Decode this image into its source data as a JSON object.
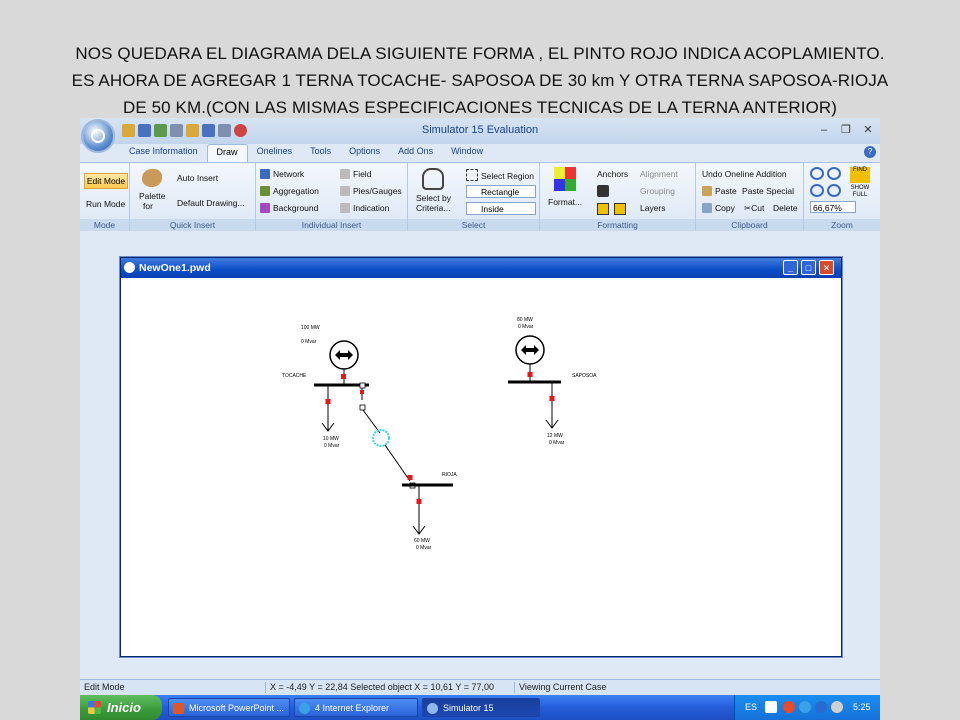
{
  "slide": {
    "caption_lines": [
      "NOS QUEDARA EL DIAGRAMA DELA SIGUIENTE FORMA , EL PINTO ROJO INDICA ACOPLAMIENTO.",
      "ES AHORA DE AGREGAR 1 TERNA  TOCACHE- SAPOSOA DE 30 km Y OTRA TERNA SAPOSOA-RIOJA",
      "DE 50 KM.(CON LAS MISMAS ESPECIFICACIONES TECNICAS DE LA TERNA ANTERIOR)"
    ]
  },
  "app": {
    "title": "Simulator 15 Evaluation",
    "menu_tabs": [
      "Case Information",
      "Draw",
      "Onelines",
      "Tools",
      "Options",
      "Add Ons",
      "Window"
    ],
    "active_tab": "Draw"
  },
  "ribbon": {
    "mode": {
      "label": "Mode",
      "edit_mode": "Edit Mode",
      "run_mode": "Run Mode"
    },
    "quick_insert": {
      "label": "Quick Insert",
      "palette": "Palette",
      "palette_for": "for",
      "auto_insert": "Auto Insert",
      "default_drawing": "Default Drawing..."
    },
    "individual_insert": {
      "label": "Individual Insert",
      "network": "Network",
      "aggregation": "Aggregation",
      "background": "Background",
      "field": "Field",
      "pies_gauges": "Pies/Gauges",
      "indication": "Indication"
    },
    "select": {
      "label": "Select",
      "select_by": "Select by",
      "criteria": "Criteria...",
      "select_region": "Select Region",
      "rectangle": "Rectangle",
      "inside": "Inside"
    },
    "formatting": {
      "label": "Formatting",
      "format": "Format...",
      "anchors": "Anchors",
      "alignment": "Alignment",
      "grouping": "Grouping",
      "layers": "Layers"
    },
    "clipboard": {
      "label": "Clipboard",
      "undo": "Undo Oneline Addition",
      "paste": "Paste",
      "paste_special": "Paste Special",
      "copy": "Copy",
      "cut": "Cut",
      "delete": "Delete"
    },
    "zoom": {
      "label": "Zoom",
      "value": "66,67%",
      "find": "FIND",
      "show_full_1": "SHOW",
      "show_full_2": "FULL"
    }
  },
  "child_window": {
    "title": "NewOne1.pwd"
  },
  "diagram": {
    "buses": [
      {
        "name": "TOCACHE"
      },
      {
        "name": "SAPOSOA"
      },
      {
        "name": "RIOJA"
      }
    ],
    "generators": [
      {
        "mw": "100 MW",
        "mvar": "0 Mvar"
      },
      {
        "mw": "80 MW",
        "mvar": "0 Mvar"
      }
    ],
    "loads": [
      {
        "mw": "10 MW",
        "mvar": "0 Mvar"
      },
      {
        "mw": "12 MW",
        "mvar": "0 Mvar"
      },
      {
        "mw": "60 MW",
        "mvar": "0 Mvar"
      }
    ],
    "colors": {
      "coupling": "#e01818",
      "transformer": "#3fd6e6",
      "line": "#000000"
    }
  },
  "status_bar": {
    "mode": "Edit Mode",
    "coords": "X = -4,49 Y = 22,84 Selected object X = 10,61 Y = 77,00",
    "view": "Viewing Current Case"
  },
  "taskbar": {
    "start": "Inicio",
    "tasks": [
      "Microsoft PowerPoint ...",
      "4 Internet Explorer",
      "Simulator 15"
    ],
    "lang": "ES",
    "clock": "5:25"
  }
}
